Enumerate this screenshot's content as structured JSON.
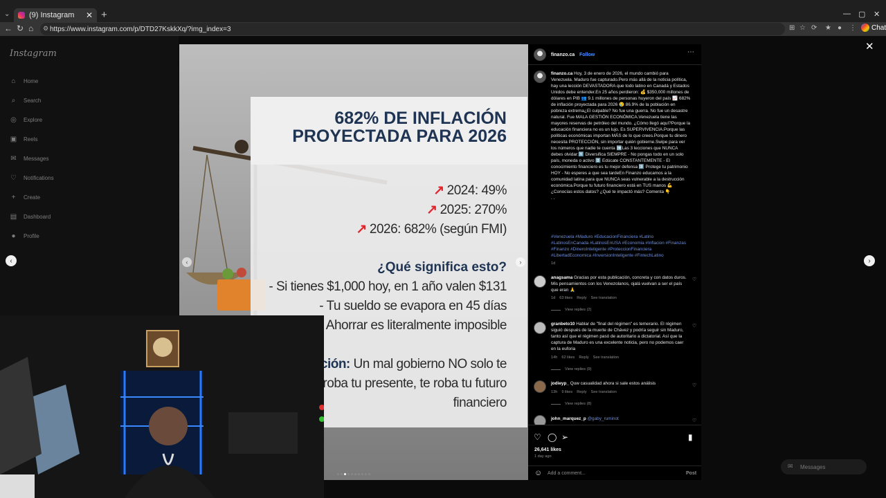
{
  "browser": {
    "tab_title": "(9) Instagram",
    "url": "https://www.instagram.com/p/DTD27KskkXq/?img_index=3",
    "chat_label": "Chat"
  },
  "sidebar": {
    "logo": "Instagram",
    "items": [
      {
        "label": "Home",
        "icon": "home-icon"
      },
      {
        "label": "Search",
        "icon": "search-icon"
      },
      {
        "label": "Explore",
        "icon": "compass-icon"
      },
      {
        "label": "Reels",
        "icon": "reels-icon"
      },
      {
        "label": "Messages",
        "icon": "messenger-icon"
      },
      {
        "label": "Notifications",
        "icon": "heart-icon"
      },
      {
        "label": "Create",
        "icon": "plus-icon"
      },
      {
        "label": "Dashboard",
        "icon": "dashboard-icon"
      },
      {
        "label": "Profile",
        "icon": "avatar-icon"
      }
    ]
  },
  "slide": {
    "title": "682% DE INFLACIÓN PROYECTADA PARA 2026",
    "stats": [
      "2024: 49%",
      "2025: 270%",
      "2026: 682% (según FMI)"
    ],
    "question": "¿Qué significa esto?",
    "lines": [
      "- Si tienes $1,000 hoy, en 1 año valen $131",
      "- Tu sueldo se evapora en 45 días",
      "Ahorrar es literalmente imposible"
    ],
    "conclusion_label": "ción:",
    "conclusion_lines": [
      "Un mal gobierno NO solo te",
      "roba tu presente, te roba tu futuro",
      "financiero"
    ]
  },
  "post": {
    "author": "finanzo.ca",
    "follow": "Follow",
    "caption_author": "finanzo.ca",
    "caption": "Hoy, 3 de enero de 2026, el mundo cambió para Venezuela. Maduro fue capturado.Pero más allá de la noticia política, hay una lección DEVASTADORA que todo latino en Canadá y Estados Unidos debe entender.En 25 años perdieron: 💰 $350,000 millones de dólares en PIB 👥 9.1 millones de personas huyeron del país 📈 682% de inflación proyectada para 2026 😢 86.9% de la población en pobreza extrema¿El culpable? No fue una guerra. No fue un desastre natural. Fue MALA GESTIÓN ECONÓMICA.Venezuela tiene las mayores reservas de petróleo del mundo. ¿Cómo llegó aquí?Porque la educación financiera no es un lujo. Es SUPERVIVENCIA.Porque las políticas económicas importan MÁS de lo que crees.Porque tu dinero necesita PROTECCIÓN, sin importar quién gobierne.Swipe para ver los números que nadie te cuenta ➡️Las 3 lecciones que NUNCA debes olvidar:1️⃣ Diversifica SIEMPRE - No pongas todo en un solo país, moneda o activo 2️⃣ Edúcate CONSTANTEMENTE - El conocimiento financiero es tu mejor defensa 3️⃣ Protege tu patrimonio HOY - No esperes a que sea tardeEn Finanzo educamos a la comunidad latina para que NUNCA seas vulnerable a la destrucción económica.Porque tu futuro financiero está en TUS manos 💪¿Conocías estos datos? ¿Qué te impactó más? Comenta 👇",
    "dots": ". .",
    "hashtags": "#Venezuela #Maduro #EducacionFinanciera #Latino #LatinosEnCanada #LatinosEnUSA #Economia #Inflacion #Finanzas #Finanzo #DineroInteligente #ProteccionFinanciera #LibertadEconomica #InversionInteligente #FintechLatino",
    "caption_time": "1d",
    "comments": [
      {
        "user": "anagsama",
        "text": "Gracias por esta publicación, concreta y con datos duros. Mis pensamientos con los Venezolanos, ojalá vuelvan a ser el país que eran 🙏",
        "time": "1d",
        "likes": "63 likes",
        "reply": "Reply",
        "translate": "See translation",
        "replies": "View replies (2)"
      },
      {
        "user": "granbeto10",
        "text": "Hablar de \"final del régimen\" es temerario. El régimen siguió después de la muerte de Chávez y podría seguir sin Maduro, tanto así que el régimen pasó de autoritario a dictatorial. Así que la captura de Maduro es una excelente noticia, pero no podemos caer en la euforia",
        "time": "14h",
        "likes": "62 likes",
        "reply": "Reply",
        "translate": "See translation",
        "replies": "View replies (9)"
      },
      {
        "user": "jodieyp_",
        "text": "Quw casualidad ahora si sale estos análisis",
        "time": "13h",
        "likes": "9 likes",
        "reply": "Reply",
        "translate": "See translation",
        "replies": "View replies (8)"
      },
      {
        "user": "john_marquez_p",
        "text": "@gaby_ruminot",
        "time": "",
        "likes": "",
        "reply": "",
        "translate": "",
        "replies": ""
      }
    ],
    "likes": "26,641 likes",
    "ago": "1 day ago",
    "add_comment": "Add a comment...",
    "post_btn": "Post"
  },
  "messages_pill": "Messages",
  "colors": {
    "accent": "#4a90ff",
    "slide_title": "#1f3452",
    "trend_red": "#e0262d"
  }
}
